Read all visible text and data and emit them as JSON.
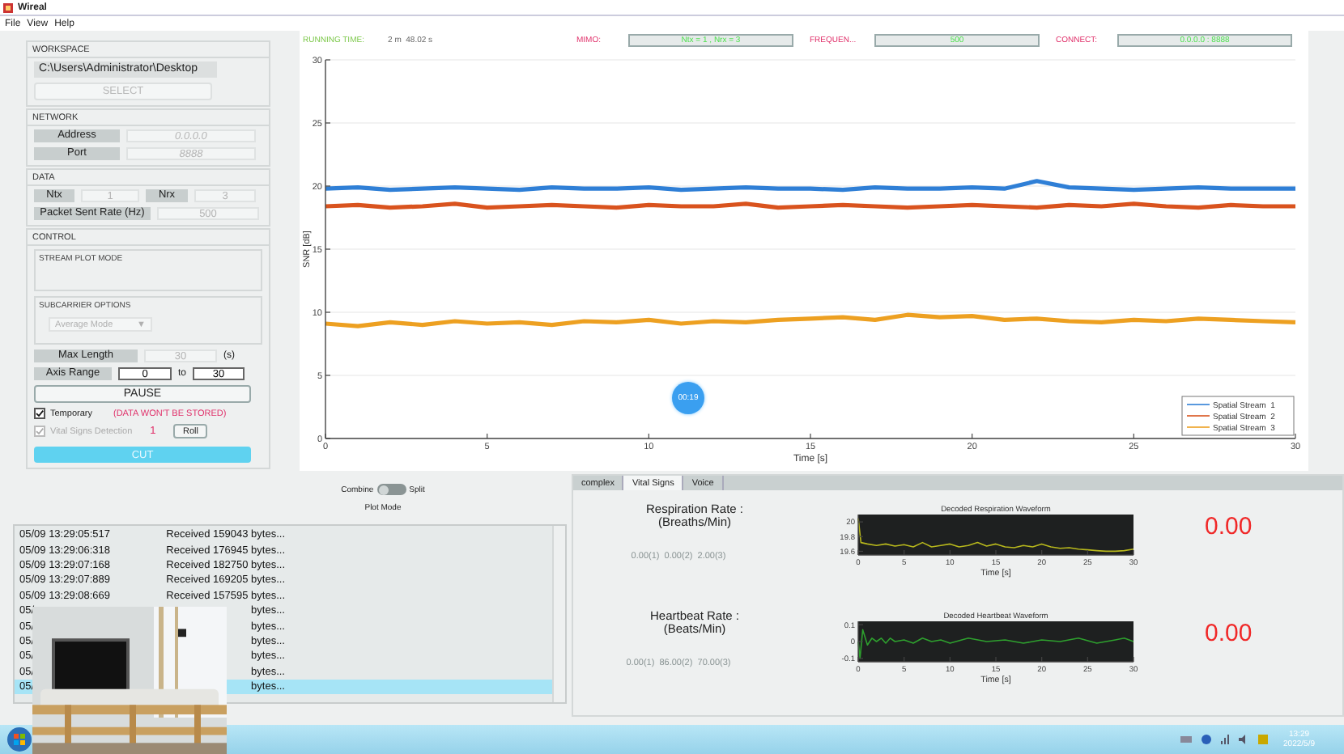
{
  "window": {
    "title": "Wireal"
  },
  "menu": [
    "File",
    "View",
    "Help"
  ],
  "workspace": {
    "heading": "WORKSPACE",
    "path": "C:\\Users\\Administrator\\Desktop",
    "select_button": {
      "label": "SELECT",
      "disabled": true
    }
  },
  "network": {
    "heading": "NETWORK",
    "fields": [
      {
        "label": "Address",
        "value": "0.0.0.0",
        "disabled": true
      },
      {
        "label": "Port",
        "value": "8888",
        "disabled": true
      }
    ]
  },
  "data": {
    "heading": "DATA",
    "ntx": {
      "label": "Ntx",
      "value": "1",
      "disabled": true
    },
    "nrx": {
      "label": "Nrx",
      "value": "3",
      "disabled": true
    },
    "rate": {
      "label": "Packet Sent Rate (Hz)",
      "value": "500",
      "disabled": true
    }
  },
  "control": {
    "heading": "CONTROL",
    "stream_plot_mode": {
      "heading": "STREAM PLOT MODE"
    },
    "subcarrier_options": {
      "heading": "SUBCARRIER OPTIONS",
      "dropdown": {
        "value": "Average Mode",
        "arrow": "▼",
        "disabled": true
      }
    },
    "max_length": {
      "label": "Max Length",
      "value": "30",
      "disabled": true,
      "unit": "(s)"
    },
    "axis_range": {
      "label": "Axis Range",
      "from": {
        "value": "0",
        "disabled": false
      },
      "to_label": "to",
      "to": {
        "value": "30",
        "disabled": false
      }
    },
    "pause_button": "PAUSE",
    "temporary": {
      "label": "Temporary",
      "checked": true,
      "disabled": false
    },
    "warning": "(DATA WON'T BE STORED)",
    "vital_signs": {
      "label": "Vital Signs Detection",
      "checked": true,
      "disabled": true
    },
    "vital_count": "1",
    "roll_button": "Roll",
    "cut_button": "CUT"
  },
  "status": {
    "running_label": "RUNNING TIME:",
    "running_value": "2 m  48.02 s",
    "fields": [
      {
        "label": "MIMO:",
        "value": "Ntx = 1 , Nrx = 3"
      },
      {
        "label": "FREQUEN...",
        "value": "500"
      },
      {
        "label": "CONNECT:",
        "value": "0.0.0.0 : 8888"
      }
    ]
  },
  "snr_plot": {
    "timer_badge": "00:19",
    "chart_data": {
      "type": "line",
      "grid": true,
      "legend": true,
      "xlabel": "Time [s]",
      "ylabel": "SNR [dB]",
      "xlim": [
        0,
        30
      ],
      "ylim": [
        0,
        30
      ],
      "xticks": [
        {
          "value": 0,
          "label": "0"
        },
        {
          "value": 5,
          "label": "5"
        },
        {
          "value": 10,
          "label": "10"
        },
        {
          "value": 15,
          "label": "15"
        },
        {
          "value": 20,
          "label": "20"
        },
        {
          "value": 25,
          "label": "25"
        },
        {
          "value": 30,
          "label": "30"
        }
      ],
      "yticks": [
        {
          "value": 0,
          "label": "0"
        },
        {
          "value": 5,
          "label": "5"
        },
        {
          "value": 10,
          "label": "10"
        },
        {
          "value": 15,
          "label": "15"
        },
        {
          "value": 20,
          "label": "20"
        },
        {
          "value": 25,
          "label": "25"
        },
        {
          "value": 30,
          "label": "30"
        }
      ],
      "x": [
        0,
        1,
        2,
        3,
        4,
        5,
        6,
        7,
        8,
        9,
        10,
        11,
        12,
        13,
        14,
        15,
        16,
        17,
        18,
        19,
        20,
        21,
        22,
        23,
        24,
        25,
        26,
        27,
        28,
        29,
        30
      ],
      "series": [
        {
          "name": "Spatial Stream  1",
          "color": "#2f7fd6",
          "values": [
            19.8,
            19.9,
            19.7,
            19.8,
            19.9,
            19.8,
            19.7,
            19.9,
            19.8,
            19.8,
            19.9,
            19.7,
            19.8,
            19.9,
            19.8,
            19.8,
            19.7,
            19.9,
            19.8,
            19.8,
            19.9,
            19.8,
            20.4,
            19.9,
            19.8,
            19.7,
            19.8,
            19.9,
            19.8,
            19.8,
            19.8
          ]
        },
        {
          "name": "Spatial Stream  2",
          "color": "#d9531e",
          "values": [
            18.4,
            18.5,
            18.3,
            18.4,
            18.6,
            18.3,
            18.4,
            18.5,
            18.4,
            18.3,
            18.5,
            18.4,
            18.4,
            18.6,
            18.3,
            18.4,
            18.5,
            18.4,
            18.3,
            18.4,
            18.5,
            18.4,
            18.3,
            18.5,
            18.4,
            18.6,
            18.4,
            18.3,
            18.5,
            18.4,
            18.4
          ]
        },
        {
          "name": "Spatial Stream  3",
          "color": "#eda021",
          "values": [
            9.1,
            8.9,
            9.2,
            9.0,
            9.3,
            9.1,
            9.2,
            9.0,
            9.3,
            9.2,
            9.4,
            9.1,
            9.3,
            9.2,
            9.4,
            9.5,
            9.6,
            9.4,
            9.8,
            9.6,
            9.7,
            9.4,
            9.5,
            9.3,
            9.2,
            9.4,
            9.3,
            9.5,
            9.4,
            9.3,
            9.2
          ]
        }
      ]
    }
  },
  "plot_mode": {
    "left": "Combine",
    "right": "Split",
    "on": false,
    "caption": "Plot Mode"
  },
  "log": {
    "rows": [
      {
        "time": "05/09 13:29:05:517",
        "message": "Received 159043 bytes...",
        "selected": false
      },
      {
        "time": "05/09 13:29:06:318",
        "message": "Received 176945 bytes...",
        "selected": false
      },
      {
        "time": "05/09 13:29:07:168",
        "message": "Received 182750 bytes...",
        "selected": false
      },
      {
        "time": "05/09 13:29:07:889",
        "message": "Received 169205 bytes...",
        "selected": false
      },
      {
        "time": "05/09 13:29:08:669",
        "message": "Received 157595 bytes...",
        "selected": false
      },
      {
        "time": "05/",
        "message": "bytes...",
        "selected": false
      },
      {
        "time": "05/",
        "message": "bytes...",
        "selected": false
      },
      {
        "time": "05/",
        "message": "bytes...",
        "selected": false
      },
      {
        "time": "05/",
        "message": "bytes...",
        "selected": false
      },
      {
        "time": "05/",
        "message": "bytes...",
        "selected": false
      },
      {
        "time": "05/",
        "message": "bytes...",
        "selected": true
      }
    ]
  },
  "vital_tabs": {
    "tabs": [
      {
        "label": "complex",
        "selected": false
      },
      {
        "label": "Vital Signs",
        "selected": true
      },
      {
        "label": "Voice",
        "selected": false
      }
    ],
    "panels": [
      {
        "label": "Respiration Rate :",
        "unit": "(Breaths/Min)",
        "readings": "0.00(1)  0.00(2)  2.00(3)",
        "value": "0.00",
        "chart_data": {
          "type": "line",
          "title": "Decoded Respiration Waveform",
          "xlabel": "Time [s]",
          "xlim": [
            0,
            30
          ],
          "ylim": [
            19.55,
            20.1
          ],
          "xticks": [
            0,
            5,
            10,
            15,
            20,
            25,
            30
          ],
          "yticks": [
            19.6,
            19.8,
            20
          ],
          "x": [
            0,
            0.3,
            1,
            2,
            3,
            4,
            5,
            6,
            7,
            8,
            9,
            10,
            11,
            12,
            13,
            14,
            15,
            16,
            17,
            18,
            19,
            20,
            21,
            22,
            23,
            24,
            25,
            26,
            27,
            28,
            29,
            30
          ],
          "series": [
            {
              "color": "#b8b81c",
              "values": [
                20.05,
                19.72,
                19.7,
                19.68,
                19.7,
                19.67,
                19.69,
                19.66,
                19.72,
                19.66,
                19.68,
                19.7,
                19.66,
                19.68,
                19.72,
                19.67,
                19.7,
                19.66,
                19.65,
                19.68,
                19.66,
                19.7,
                19.66,
                19.64,
                19.65,
                19.63,
                19.62,
                19.61,
                19.6,
                19.6,
                19.61,
                19.63
              ]
            }
          ]
        }
      },
      {
        "label": "Heartbeat Rate :",
        "unit": "(Beats/Min)",
        "readings": "0.00(1)  86.00(2)  70.00(3)",
        "value": "0.00",
        "chart_data": {
          "type": "line",
          "title": "Decoded Heartbeat Waveform",
          "xlabel": "Time [s]",
          "xlim": [
            0,
            30
          ],
          "ylim": [
            -0.12,
            0.12
          ],
          "xticks": [
            0,
            5,
            10,
            15,
            20,
            25,
            30
          ],
          "yticks": [
            -0.1,
            0,
            0.1
          ],
          "x": [
            0,
            0.2,
            0.5,
            1,
            1.5,
            2,
            2.5,
            3,
            3.5,
            4,
            5,
            6,
            7,
            8,
            9,
            10,
            12,
            14,
            16,
            18,
            20,
            22,
            24,
            26,
            28,
            29,
            30
          ],
          "series": [
            {
              "color": "#2ea02e",
              "values": [
                0,
                -0.1,
                0.07,
                -0.02,
                0.02,
                0,
                0.02,
                -0.01,
                0.02,
                0,
                0.01,
                -0.01,
                0.02,
                0,
                0.01,
                -0.01,
                0.02,
                0,
                0.01,
                -0.01,
                0.01,
                0,
                0.02,
                -0.01,
                0.01,
                0.02,
                0
              ]
            }
          ]
        }
      }
    ]
  },
  "taskbar": {
    "time": "13:29",
    "date": "2022/5/9"
  }
}
